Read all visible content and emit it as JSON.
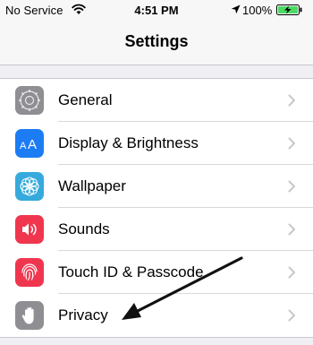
{
  "status_bar": {
    "carrier": "No Service",
    "time": "4:51 PM",
    "battery_percent": "100%",
    "icons": [
      "wifi-icon",
      "location-arrow-icon",
      "battery-charging-icon"
    ]
  },
  "nav": {
    "title": "Settings"
  },
  "settings": {
    "items": [
      {
        "label": "General",
        "icon": "gear-icon",
        "color": "#8e8e93"
      },
      {
        "label": "Display & Brightness",
        "icon": "text-size-icon",
        "color": "#1c7cf4"
      },
      {
        "label": "Wallpaper",
        "icon": "flower-icon",
        "color": "#36aadc"
      },
      {
        "label": "Sounds",
        "icon": "speaker-icon",
        "color": "#f0364f"
      },
      {
        "label": "Touch ID & Passcode",
        "icon": "fingerprint-icon",
        "color": "#f0364f"
      },
      {
        "label": "Privacy",
        "icon": "hand-icon",
        "color": "#8e8e93"
      }
    ]
  },
  "annotation": {
    "type": "arrow",
    "points_to": "Privacy",
    "color": "#111111"
  }
}
